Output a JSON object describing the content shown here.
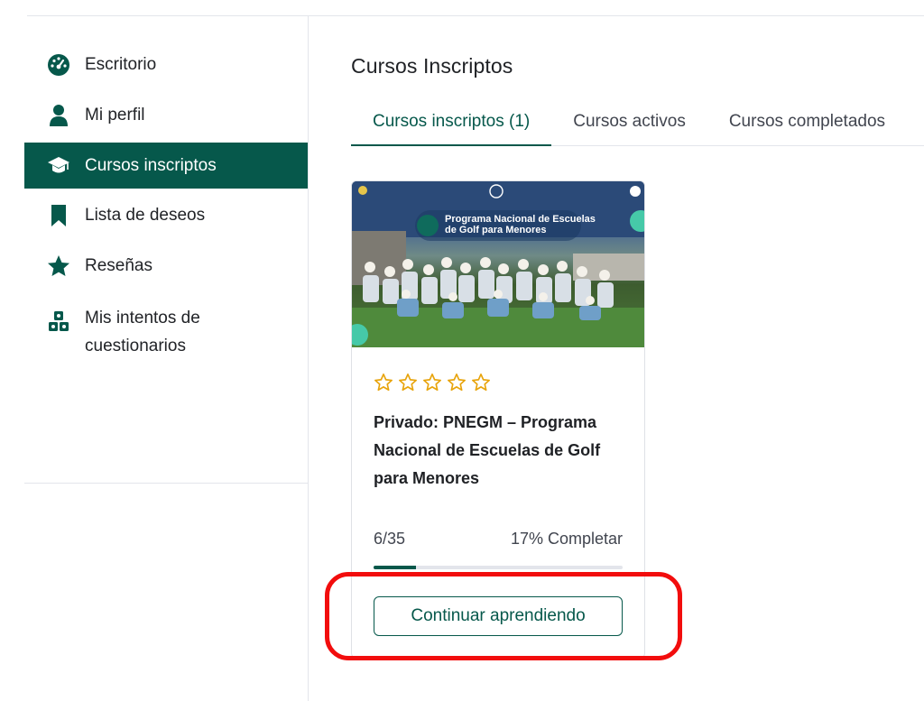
{
  "sidebar": {
    "items": [
      {
        "label": "Escritorio",
        "icon": "dashboard-gauge-icon"
      },
      {
        "label": "Mi perfil",
        "icon": "user-icon"
      },
      {
        "label": "Cursos inscriptos",
        "icon": "graduation-cap-icon",
        "active": true
      },
      {
        "label": "Lista de deseos",
        "icon": "bookmark-icon"
      },
      {
        "label": "Reseñas",
        "icon": "star-icon"
      },
      {
        "label": "Mis intentos de cuestionarios",
        "icon": "quiz-blocks-icon"
      }
    ]
  },
  "main": {
    "title": "Cursos Inscriptos",
    "tabs": [
      {
        "label": "Cursos inscriptos (1)",
        "active": true
      },
      {
        "label": "Cursos activos"
      },
      {
        "label": "Cursos completados"
      }
    ]
  },
  "course": {
    "thumbnail_text": "Programa Nacional de Escuelas de Golf para Menores",
    "rating_stars": 0,
    "rating_max": 5,
    "title": "Privado: PNEGM – Programa Nacional de Escuelas de Golf para Menores",
    "progress_count": "6/35",
    "progress_label": "17% Completar",
    "progress_percent": 17,
    "button_label": "Continuar aprendiendo"
  },
  "colors": {
    "primary": "#06584b",
    "star": "#e8a40c",
    "highlight": "#f20d0d"
  }
}
